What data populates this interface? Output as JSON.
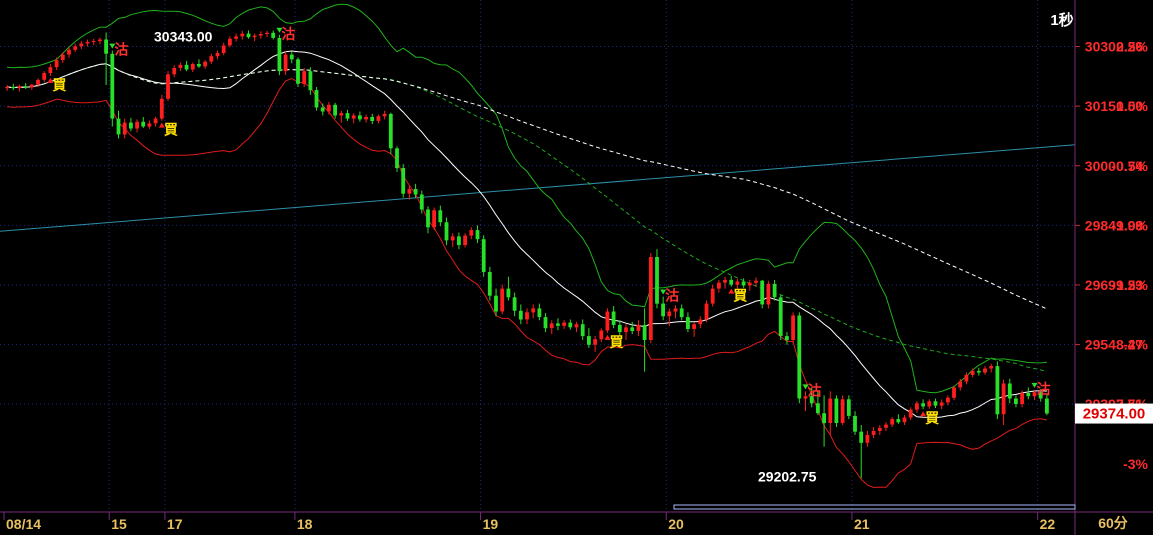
{
  "chart_data": {
    "type": "candlestick",
    "interval_label": "1秒",
    "period_label": "60分",
    "colors": {
      "background": "#000000",
      "up": "#ff1e1e",
      "down": "#28e028",
      "ma_short": "#ffffff",
      "boll_upper": "#21b21b",
      "boll_lower": "#e01b1b",
      "ma_mid": "#1fa81f",
      "ma_long": "#ffffff",
      "trend": "#2e8fa8",
      "price_axis_text": "#ff2b2b",
      "grid": "#1a2a8a",
      "last_price_box": "#ffffff"
    },
    "y_axis": {
      "ylim": [
        29125,
        30420
      ],
      "price_ticks": [
        "30302.26",
        "30151.50",
        "30000.74",
        "29849.98",
        "29699.23",
        "29548.47",
        "29397.71"
      ],
      "price_tick_values": [
        30302.26,
        30151.5,
        30000.74,
        29849.98,
        29699.23,
        29548.47,
        29397.71
      ],
      "pct_ticks": [
        "0.5%",
        "0.0%",
        "-0.5%",
        "-1.0%",
        "-1.5%",
        "-2%",
        "-2.5%",
        "-3%"
      ],
      "pct_tick_values": [
        0.5,
        0.0,
        -0.5,
        -1.0,
        -1.5,
        -2.0,
        -2.5,
        -3.0
      ],
      "base_price": 30151.5
    },
    "last_price": "29374.00",
    "last_price_value": 29374.0,
    "high_annotation": "30343.00",
    "high_value": 30343.0,
    "low_annotation": "29202.75",
    "low_value": 29202.75,
    "x_axis": {
      "date_labels": [
        "08/14",
        "15",
        "17",
        "18",
        "19",
        "20",
        "21",
        "22"
      ],
      "date_label_index": [
        0,
        17,
        26,
        47,
        77,
        107,
        137,
        167
      ]
    },
    "signal_labels": {
      "buy": "買",
      "sell": "沽"
    },
    "signals": [
      {
        "type": "buy",
        "i": 7
      },
      {
        "type": "sell",
        "i": 17
      },
      {
        "type": "buy",
        "i": 25
      },
      {
        "type": "sell",
        "i": 44
      },
      {
        "type": "buy",
        "i": 97
      },
      {
        "type": "sell",
        "i": 106
      },
      {
        "type": "buy",
        "i": 117
      },
      {
        "type": "sell",
        "i": 129
      },
      {
        "type": "buy",
        "i": 148
      },
      {
        "type": "sell",
        "i": 166
      }
    ],
    "candles": [
      [
        30197,
        30205,
        30190,
        30200
      ],
      [
        30200,
        30208,
        30192,
        30197
      ],
      [
        30197,
        30206,
        30189,
        30202
      ],
      [
        30202,
        30210,
        30195,
        30199
      ],
      [
        30199,
        30208,
        30193,
        30206
      ],
      [
        30206,
        30222,
        30200,
        30218
      ],
      [
        30218,
        30240,
        30212,
        30235
      ],
      [
        30235,
        30258,
        30228,
        30250
      ],
      [
        30250,
        30275,
        30243,
        30268
      ],
      [
        30268,
        30288,
        30261,
        30282
      ],
      [
        30282,
        30300,
        30274,
        30294
      ],
      [
        30294,
        30310,
        30288,
        30303
      ],
      [
        30303,
        30316,
        30296,
        30310
      ],
      [
        30310,
        30320,
        30302,
        30314
      ],
      [
        30314,
        30322,
        30306,
        30316
      ],
      [
        30316,
        30325,
        30308,
        30320
      ],
      [
        30320,
        30338,
        30205,
        30284
      ],
      [
        30284,
        30292,
        30100,
        30120
      ],
      [
        30120,
        30140,
        30070,
        30080
      ],
      [
        30080,
        30120,
        30070,
        30110
      ],
      [
        30110,
        30122,
        30088,
        30095
      ],
      [
        30095,
        30118,
        30085,
        30112
      ],
      [
        30112,
        30124,
        30096,
        30100
      ],
      [
        30100,
        30115,
        30094,
        30108
      ],
      [
        30108,
        30125,
        30100,
        30120
      ],
      [
        30120,
        30180,
        30115,
        30170
      ],
      [
        30170,
        30240,
        30165,
        30232
      ],
      [
        30232,
        30255,
        30225,
        30248
      ],
      [
        30248,
        30262,
        30240,
        30256
      ],
      [
        30256,
        30266,
        30240,
        30244
      ],
      [
        30244,
        30262,
        30238,
        30258
      ],
      [
        30258,
        30270,
        30248,
        30252
      ],
      [
        30252,
        30268,
        30246,
        30264
      ],
      [
        30264,
        30284,
        30258,
        30278
      ],
      [
        30278,
        30292,
        30270,
        30286
      ],
      [
        30286,
        30312,
        30280,
        30305
      ],
      [
        30305,
        30328,
        30300,
        30322
      ],
      [
        30322,
        30335,
        30315,
        30328
      ],
      [
        30328,
        30342,
        30320,
        30335
      ],
      [
        30335,
        30343,
        30322,
        30326
      ],
      [
        30326,
        30335,
        30316,
        30330
      ],
      [
        30330,
        30341,
        30322,
        30334
      ],
      [
        30334,
        30342,
        30326,
        30337
      ],
      [
        30337,
        30343,
        30320,
        30324
      ],
      [
        30324,
        30332,
        30230,
        30240
      ],
      [
        30240,
        30290,
        30230,
        30282
      ],
      [
        30282,
        30290,
        30260,
        30270
      ],
      [
        30270,
        30275,
        30200,
        30208
      ],
      [
        30208,
        30248,
        30200,
        30240
      ],
      [
        30240,
        30250,
        30180,
        30192
      ],
      [
        30192,
        30200,
        30140,
        30148
      ],
      [
        30148,
        30158,
        30128,
        30138
      ],
      [
        30138,
        30162,
        30130,
        30155
      ],
      [
        30155,
        30160,
        30120,
        30128
      ],
      [
        30128,
        30140,
        30110,
        30134
      ],
      [
        30134,
        30142,
        30114,
        30120
      ],
      [
        30120,
        30134,
        30108,
        30128
      ],
      [
        30128,
        30138,
        30112,
        30118
      ],
      [
        30118,
        30130,
        30110,
        30124
      ],
      [
        30124,
        30132,
        30106,
        30114
      ],
      [
        30114,
        30130,
        30108,
        30126
      ],
      [
        30126,
        30140,
        30118,
        30132
      ],
      [
        30132,
        30135,
        30030,
        30045
      ],
      [
        30045,
        30050,
        29985,
        29995
      ],
      [
        29995,
        30005,
        29920,
        29930
      ],
      [
        29930,
        29950,
        29915,
        29942
      ],
      [
        29942,
        29955,
        29920,
        29928
      ],
      [
        29928,
        29938,
        29880,
        29890
      ],
      [
        29890,
        29898,
        29830,
        29845
      ],
      [
        29845,
        29895,
        29838,
        29888
      ],
      [
        29888,
        29900,
        29848,
        29858
      ],
      [
        29858,
        29870,
        29800,
        29812
      ],
      [
        29812,
        29830,
        29795,
        29822
      ],
      [
        29822,
        29832,
        29790,
        29800
      ],
      [
        29800,
        29830,
        29794,
        29824
      ],
      [
        29824,
        29845,
        29815,
        29838
      ],
      [
        29838,
        29850,
        29805,
        29815
      ],
      [
        29815,
        29825,
        29720,
        29732
      ],
      [
        29732,
        29745,
        29660,
        29672
      ],
      [
        29672,
        29690,
        29620,
        29632
      ],
      [
        29632,
        29700,
        29625,
        29690
      ],
      [
        29690,
        29720,
        29660,
        29668
      ],
      [
        29668,
        29680,
        29620,
        29634
      ],
      [
        29634,
        29650,
        29600,
        29612
      ],
      [
        29612,
        29640,
        29600,
        29630
      ],
      [
        29630,
        29650,
        29615,
        29640
      ],
      [
        29640,
        29652,
        29610,
        29618
      ],
      [
        29618,
        29628,
        29580,
        29590
      ],
      [
        29590,
        29610,
        29575,
        29602
      ],
      [
        29602,
        29615,
        29585,
        29596
      ],
      [
        29596,
        29610,
        29588,
        29604
      ],
      [
        29604,
        29612,
        29586,
        29592
      ],
      [
        29592,
        29606,
        29580,
        29600
      ],
      [
        29600,
        29612,
        29560,
        29570
      ],
      [
        29570,
        29590,
        29540,
        29548
      ],
      [
        29548,
        29570,
        29530,
        29562
      ],
      [
        29562,
        29590,
        29555,
        29584
      ],
      [
        29584,
        29640,
        29578,
        29632
      ],
      [
        29632,
        29646,
        29590,
        29598
      ],
      [
        29598,
        29610,
        29570,
        29580
      ],
      [
        29580,
        29600,
        29560,
        29592
      ],
      [
        29592,
        29606,
        29575,
        29583
      ],
      [
        29583,
        29610,
        29570,
        29598
      ],
      [
        29598,
        29640,
        29480,
        29560
      ],
      [
        29560,
        29780,
        29552,
        29770
      ],
      [
        29770,
        29790,
        29640,
        29652
      ],
      [
        29652,
        29670,
        29610,
        29620
      ],
      [
        29620,
        29640,
        29595,
        29632
      ],
      [
        29632,
        29648,
        29615,
        29640
      ],
      [
        29640,
        29650,
        29610,
        29618
      ],
      [
        29618,
        29630,
        29580,
        29588
      ],
      [
        29588,
        29605,
        29568,
        29600
      ],
      [
        29600,
        29620,
        29590,
        29612
      ],
      [
        29612,
        29660,
        29605,
        29652
      ],
      [
        29652,
        29700,
        29645,
        29690
      ],
      [
        29690,
        29712,
        29680,
        29705
      ],
      [
        29705,
        29720,
        29690,
        29712
      ],
      [
        29712,
        29722,
        29695,
        29700
      ],
      [
        29700,
        29715,
        29690,
        29708
      ],
      [
        29708,
        29716,
        29692,
        29698
      ],
      [
        29698,
        29712,
        29685,
        29705
      ],
      [
        29705,
        29718,
        29695,
        29710
      ],
      [
        29710,
        29712,
        29640,
        29650
      ],
      [
        29650,
        29710,
        29640,
        29702
      ],
      [
        29702,
        29712,
        29660,
        29668
      ],
      [
        29668,
        29674,
        29560,
        29570
      ],
      [
        29570,
        29580,
        29548,
        29560
      ],
      [
        29560,
        29630,
        29552,
        29622
      ],
      [
        29622,
        29630,
        29400,
        29412
      ],
      [
        29412,
        29430,
        29380,
        29418
      ],
      [
        29418,
        29440,
        29390,
        29400
      ],
      [
        29400,
        29430,
        29370,
        29375
      ],
      [
        29375,
        29420,
        29290,
        29350
      ],
      [
        29350,
        29430,
        29320,
        29412
      ],
      [
        29412,
        29420,
        29340,
        29350
      ],
      [
        29350,
        29420,
        29345,
        29410
      ],
      [
        29410,
        29420,
        29360,
        29368
      ],
      [
        29368,
        29380,
        29320,
        29328
      ],
      [
        29328,
        29345,
        29210,
        29300
      ],
      [
        29300,
        29330,
        29290,
        29320
      ],
      [
        29320,
        29340,
        29312,
        29330
      ],
      [
        29330,
        29345,
        29320,
        29338
      ],
      [
        29338,
        29352,
        29330,
        29346
      ],
      [
        29346,
        29365,
        29340,
        29360
      ],
      [
        29360,
        29372,
        29348,
        29352
      ],
      [
        29352,
        29370,
        29345,
        29364
      ],
      [
        29364,
        29390,
        29358,
        29384
      ],
      [
        29384,
        29406,
        29376,
        29400
      ],
      [
        29400,
        29410,
        29385,
        29392
      ],
      [
        29392,
        29410,
        29386,
        29405
      ],
      [
        29405,
        29412,
        29388,
        29394
      ],
      [
        29394,
        29410,
        29385,
        29402
      ],
      [
        29402,
        29420,
        29395,
        29414
      ],
      [
        29414,
        29445,
        29408,
        29440
      ],
      [
        29440,
        29462,
        29432,
        29455
      ],
      [
        29455,
        29478,
        29448,
        29472
      ],
      [
        29472,
        29488,
        29466,
        29482
      ],
      [
        29482,
        29490,
        29470,
        29478
      ],
      [
        29478,
        29494,
        29472,
        29488
      ],
      [
        29488,
        29500,
        29478,
        29494
      ],
      [
        29494,
        29506,
        29360,
        29372
      ],
      [
        29372,
        29460,
        29345,
        29450
      ],
      [
        29450,
        29462,
        29400,
        29412
      ],
      [
        29412,
        29420,
        29390,
        29398
      ],
      [
        29398,
        29432,
        29390,
        29426
      ],
      [
        29426,
        29440,
        29410,
        29418
      ],
      [
        29418,
        29434,
        29408,
        29428
      ],
      [
        29428,
        29436,
        29404,
        29412
      ],
      [
        29412,
        29424,
        29370,
        29374
      ]
    ]
  }
}
